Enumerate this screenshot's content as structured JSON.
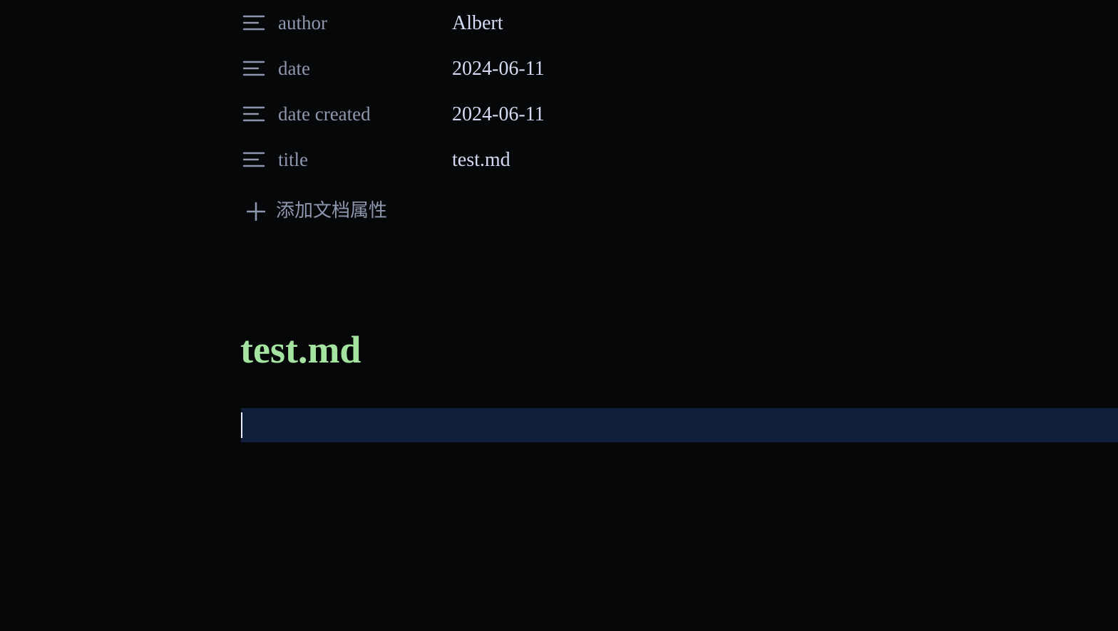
{
  "properties": [
    {
      "key": "author",
      "value": "Albert",
      "icon": "text-lines-icon"
    },
    {
      "key": "date",
      "value": "2024-06-11",
      "icon": "text-lines-icon"
    },
    {
      "key": "date created",
      "value": "2024-06-11",
      "icon": "text-lines-icon"
    },
    {
      "key": "title",
      "value": "test.md",
      "icon": "text-lines-icon"
    }
  ],
  "add_property": {
    "label": "添加文档属性",
    "icon": "plus-icon"
  },
  "document": {
    "title": "test.md",
    "body_first_line": ""
  },
  "colors": {
    "background": "#060709",
    "property_key": "#8d97ad",
    "property_value": "#d3dcf3",
    "title": "#a5e3a0",
    "active_line": "#11203a",
    "caret": "#e8eefc"
  }
}
